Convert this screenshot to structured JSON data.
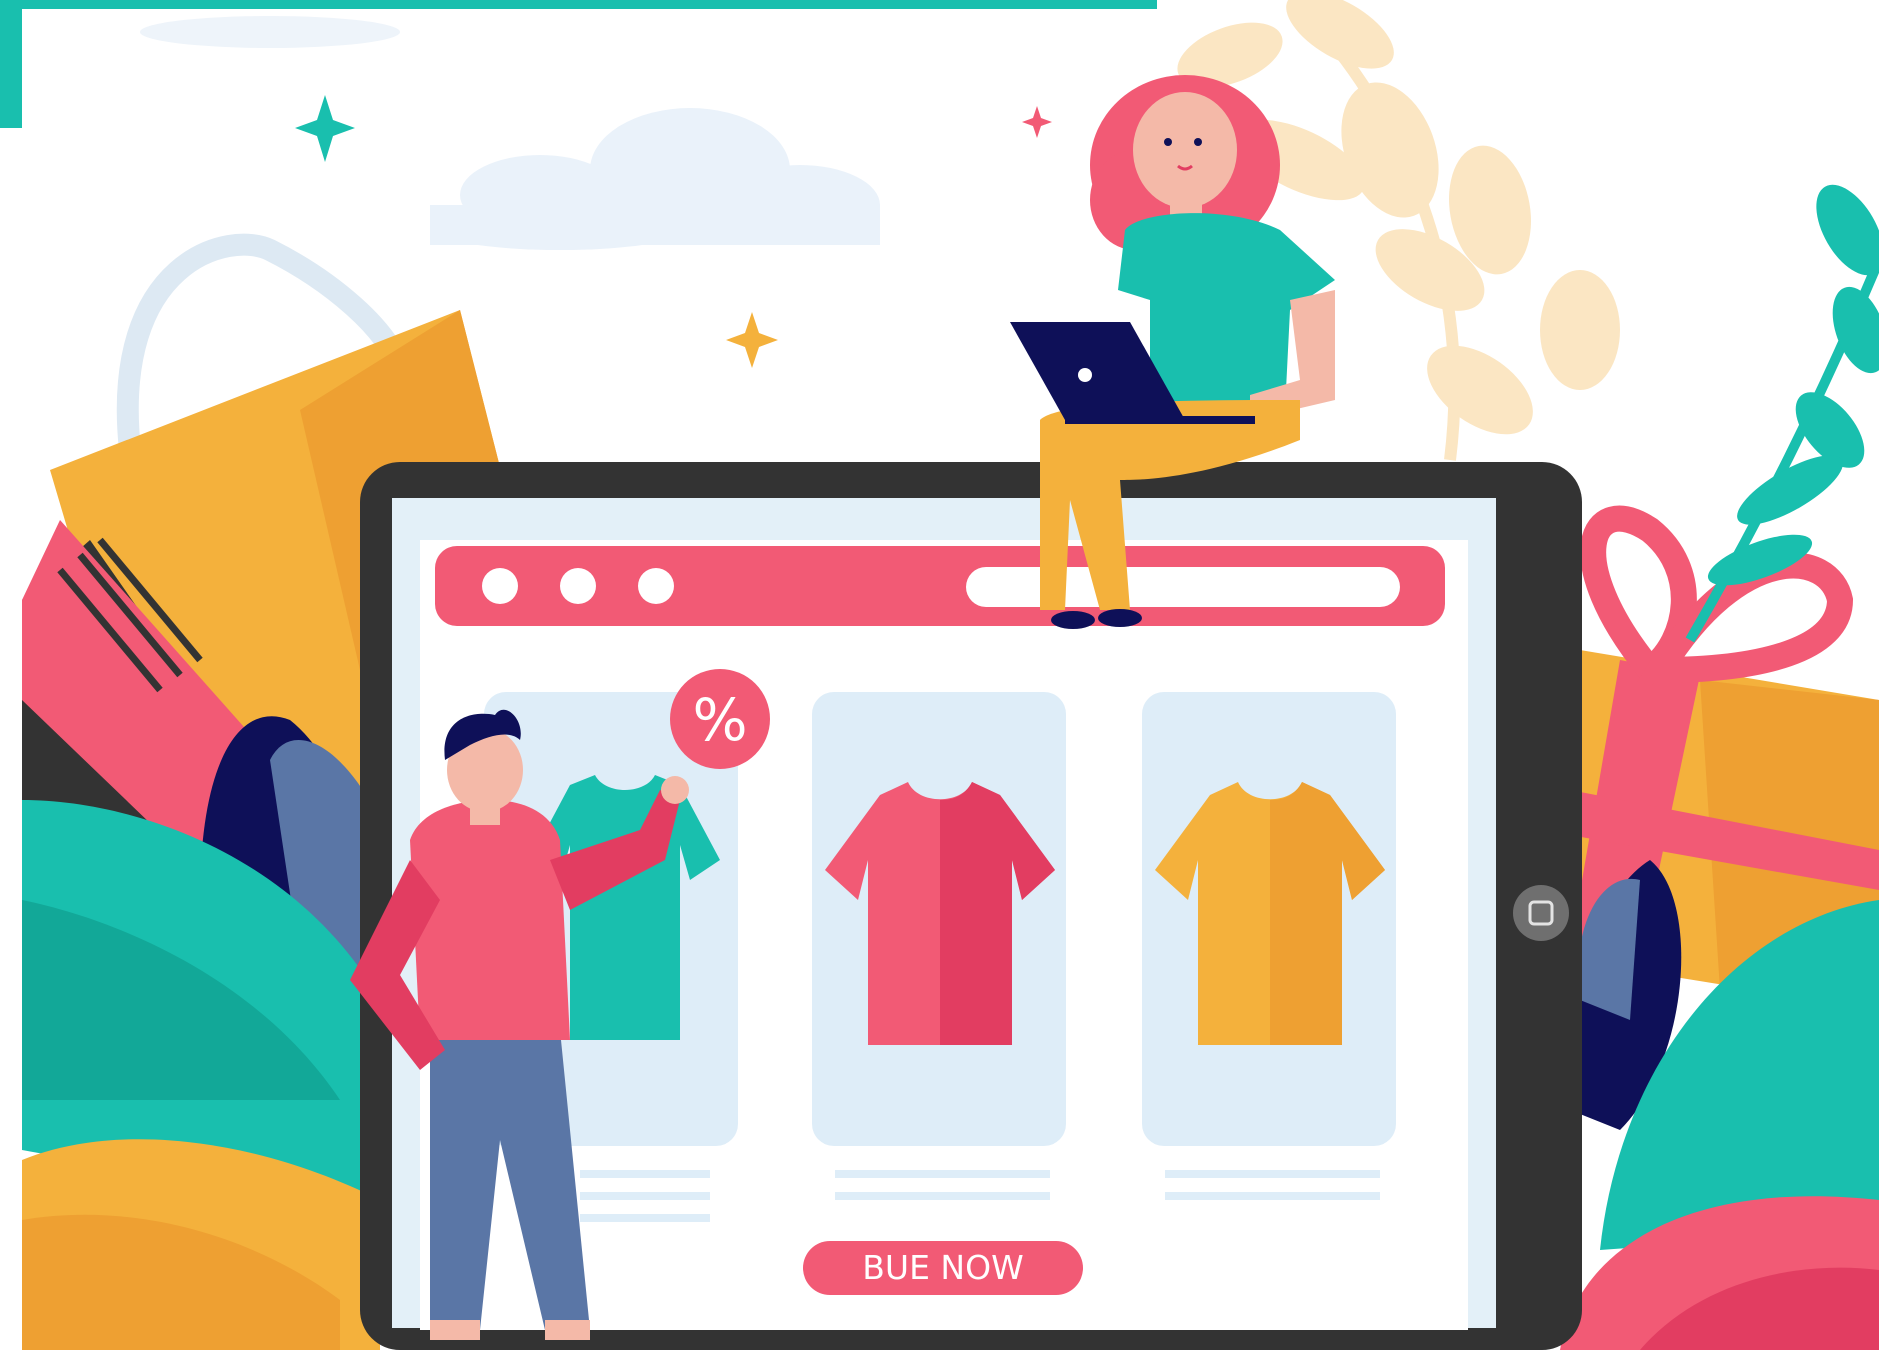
{
  "buy_button": {
    "label": "BUE NOW"
  },
  "discount_badge": {
    "symbol": "%"
  },
  "products": [
    {
      "name": "teal-tshirt",
      "color": "#19bfae"
    },
    {
      "name": "pink-tshirt",
      "color": "#ec4f6f"
    },
    {
      "name": "yellow-tshirt",
      "color": "#f4b13c"
    }
  ],
  "colors": {
    "accent_teal": "#19bfae",
    "accent_pink": "#f25a75",
    "accent_yellow": "#f4b13c",
    "tablet_frame": "#333333",
    "screen_bg": "#e3f0f8",
    "navy": "#0e1058"
  }
}
